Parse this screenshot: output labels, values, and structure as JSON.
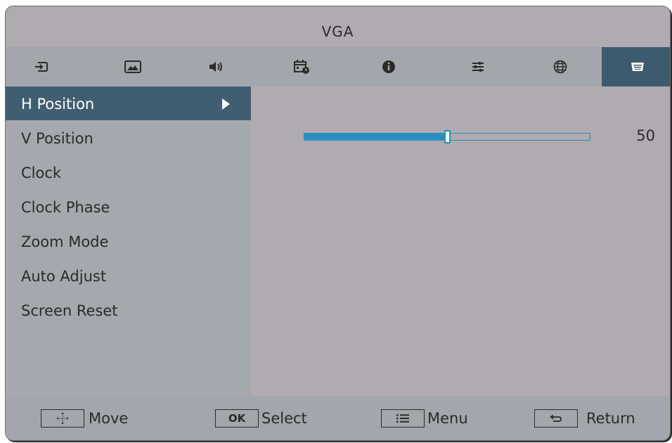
{
  "window": {
    "title": "VGA"
  },
  "tabs": [
    {
      "icon": "input-source-icon",
      "active": false
    },
    {
      "icon": "picture-icon",
      "active": false
    },
    {
      "icon": "speaker-icon",
      "active": false
    },
    {
      "icon": "calendar-clock-icon",
      "active": false
    },
    {
      "icon": "info-icon",
      "active": false
    },
    {
      "icon": "settings-sliders-icon",
      "active": false
    },
    {
      "icon": "globe-icon",
      "active": false
    },
    {
      "icon": "vga-port-icon",
      "active": true
    }
  ],
  "menu": {
    "items": [
      {
        "label": "H Position",
        "selected": true
      },
      {
        "label": "V Position",
        "selected": false
      },
      {
        "label": "Clock",
        "selected": false
      },
      {
        "label": "Clock Phase",
        "selected": false
      },
      {
        "label": "Zoom Mode",
        "selected": false
      },
      {
        "label": "Auto Adjust",
        "selected": false
      },
      {
        "label": "Screen Reset",
        "selected": false
      }
    ]
  },
  "slider": {
    "value": "50",
    "fraction": 0.5
  },
  "footer": {
    "move_label": "Move",
    "ok_key": "OK",
    "select_label": "Select",
    "menu_label": "Menu",
    "return_label": "Return"
  },
  "colors": {
    "accent": "#2a8fbf",
    "selected_bg": "#415d72",
    "panel_bg": "#b0abb0"
  }
}
